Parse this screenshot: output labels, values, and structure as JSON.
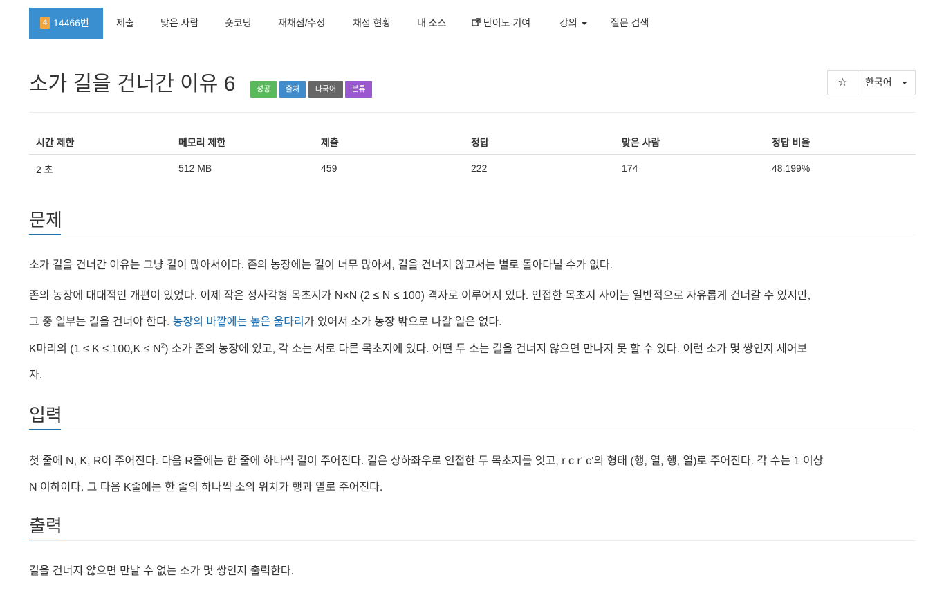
{
  "nav": {
    "tier_badge": "4",
    "active_label": "14466번",
    "items": [
      "제출",
      "맞은 사람",
      "숏코딩",
      "재채점/수정",
      "채점 현황",
      "내 소스",
      "난이도 기여",
      "강의",
      "질문 검색"
    ]
  },
  "problem": {
    "title": "소가 길을 건너간 이유 6",
    "badges": [
      {
        "label": "성공",
        "color": "#5cb85c"
      },
      {
        "label": "출처",
        "color": "#428bca"
      },
      {
        "label": "다국어",
        "color": "#666666"
      },
      {
        "label": "분류",
        "color": "#9b59d0"
      }
    ],
    "star": "☆",
    "language": "한국어"
  },
  "stats": {
    "headers": [
      "시간 제한",
      "메모리 제한",
      "제출",
      "정답",
      "맞은 사람",
      "정답 비율"
    ],
    "values": [
      "2 초",
      "512 MB",
      "459",
      "222",
      "174",
      "48.199%"
    ]
  },
  "sections": {
    "problem_heading": "문제",
    "p1": "소가 길을 건너간 이유는 그냥 길이 많아서이다. 존의 농장에는 길이 너무 많아서, 길을 건너지 않고서는 별로 돌아다닐 수가 없다.",
    "p2_line1": "존의 농장에 대대적인 개편이 있었다. 이제 작은 정사각형 목초지가 N×N (2 ≤ N ≤ 100) 격자로 이루어져 있다. 인접한 목초지 사이는 일반적으로 자유롭게 건너갈 수 있지만,",
    "p2_line2_a": "그 중 일부는 길을 건너야 한다. ",
    "p2_line2_link": "농장의 바깥에는 높은 울타리",
    "p2_line2_b": "가 있어서 소가 농장 밖으로 나갈 일은 없다.",
    "p3_line1_a": "K마리의 (1 ≤ K ≤ 100,K ≤ N",
    "p3_sup": "2",
    "p3_line1_b": ") 소가 존의 농장에 있고, 각 소는 서로 다른 목초지에 있다. 어떤 두 소는 길을 건너지 않으면 만나지 못 할 수 있다. 이런 소가 몇 쌍인지 세어보",
    "p3_line2": "자.",
    "input_heading": "입력",
    "input_line1": "첫 줄에 N, K, R이 주어진다. 다음 R줄에는 한 줄에 하나씩 길이 주어진다. 길은 상하좌우로 인접한 두 목초지를 잇고, r c r' c'의 형태 (행, 열, 행, 열)로 주어진다. 각 수는 1 이상",
    "input_line2": "N 이하이다. 그 다음 K줄에는 한 줄의 하나씩 소의 위치가 행과 열로 주어진다.",
    "output_heading": "출력",
    "output_line1": "길을 건너지 않으면 만날 수 없는 소가 몇 쌍인지 출력한다."
  }
}
